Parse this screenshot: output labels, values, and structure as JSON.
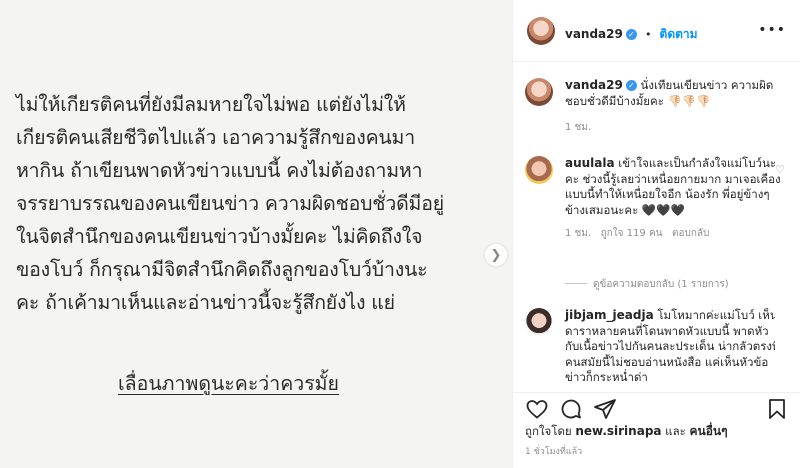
{
  "image_text": {
    "lines": [
      "ไม่ให้เกียรติคนที่ยังมีลมหายใจไม่พอ แต่ยังไม่ให้",
      "เกียรติคนเสียชีวิตไปแล้ว เอาความรู้สึกของคนมา",
      "หากิน ถ้าเขียนพาดหัวข่าวแบบนี้ คงไม่ต้องถามหา",
      "จรรยาบรรณของคนเขียนข่าว ความผิดชอบชั่วดีมีอยู่",
      "ในจิตสำนึกของคนเขียนข่าวบ้างมั้ยคะ ไม่คิดถึงใจ",
      "ของโบว์ ก็กรุณามีจิตสำนึกคิดถึงลูกของโบว์บ้างนะ",
      "คะ ถ้าเค้ามาเห็นและอ่านข่าวนี้จะรู้สึกยังไง แย่"
    ],
    "footer": "เลื่อนภาพดูนะคะว่าควรมั้ย"
  },
  "header": {
    "username": "vanda29",
    "separator": "•",
    "follow_label": "ติดตาม"
  },
  "caption": {
    "username": "vanda29",
    "text": "นั่งเทียนเขียนข่าว ความผิดชอบชั่วดีมีบ้างมั้ยคะ 👎🏻👎🏻👎🏻",
    "time": "1 ชม."
  },
  "comments": [
    {
      "username": "auulala",
      "text": "เข้าใจและเป็นกำลังใจแม่โบว์นะคะ ช่วงนี้รู้เลยว่าเหนื่อยกายมาก มาเจอเคืองแบบนี้ทำให้เหนื่อยใจอีก น้องรัก พี่อยู่ข้างๆข้างเสมอนะคะ 🖤🖤🖤",
      "time": "1 ชม.",
      "likes": "ถูกใจ 119 คน",
      "reply": "ตอบกลับ",
      "view_replies": "ดูข้อความตอบกลับ (1 รายการ)"
    },
    {
      "username": "jibjam_jeadja",
      "text": "โมโหมากค่ะแม่โบว์ เห็นดาราหลายคนที่โดนพาดหัวแบบนี้ พาดหัวกับเนื้อข่าวไปกันคนละประเด็น น่ากลัวตรงที่คนสมัยนี้ไม่ชอบอ่านหนังสือ แค่เห็นหัวข้อข่าวก็กระหน่ำด่า"
    }
  ],
  "actions": {
    "like": "heart-icon",
    "comment": "comment-icon",
    "share": "share-icon",
    "save": "bookmark-icon"
  },
  "likes_line": {
    "prefix": "ถูกใจโดย",
    "user": "new.sirinapa",
    "middle": "และ",
    "others": "คนอื่นๆ"
  },
  "post_time": "1 ชั่วโมงที่แล้ว",
  "colors": {
    "follow": "#0095f6",
    "verified": "#3897f0",
    "muted": "#8e8e8e"
  }
}
